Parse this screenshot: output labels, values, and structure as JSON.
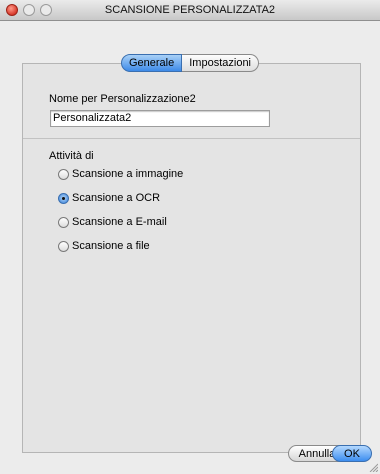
{
  "window": {
    "title": "SCANSIONE PERSONALIZZATA2"
  },
  "tabs": [
    {
      "label": "Generale",
      "active": true
    },
    {
      "label": "Impostazioni",
      "active": false
    }
  ],
  "name_section": {
    "label": "Nome per Personalizzazione2",
    "value": "Personalizzata2"
  },
  "activity_section": {
    "label": "Attività di",
    "options": [
      {
        "label": "Scansione a immagine",
        "selected": false
      },
      {
        "label": "Scansione a OCR",
        "selected": true
      },
      {
        "label": "Scansione a E-mail",
        "selected": false
      },
      {
        "label": "Scansione a file",
        "selected": false
      }
    ]
  },
  "buttons": {
    "cancel": "Annulla",
    "ok": "OK"
  },
  "colors": {
    "accent": "#3d8ae8",
    "close": "#d8392b"
  }
}
